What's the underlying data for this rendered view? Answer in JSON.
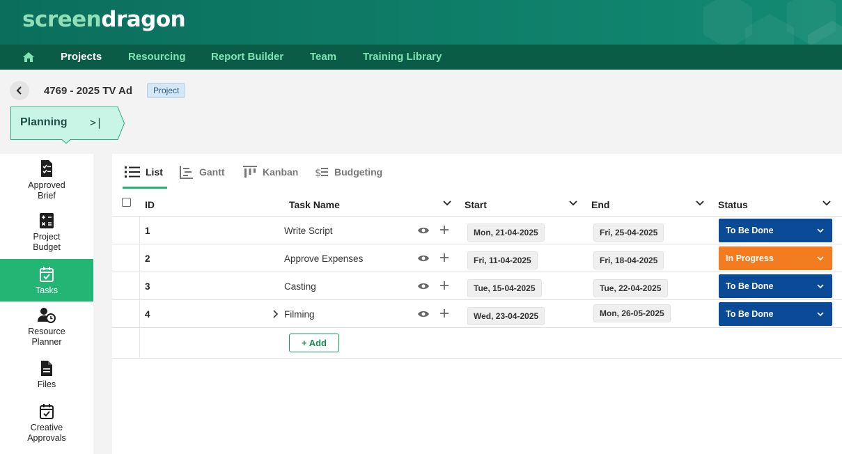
{
  "brand": {
    "part1": "screen",
    "part2": "dragon"
  },
  "nav": {
    "home_icon": "home-icon",
    "items": [
      {
        "label": "Projects",
        "active": true
      },
      {
        "label": "Resourcing"
      },
      {
        "label": "Report Builder"
      },
      {
        "label": "Team"
      },
      {
        "label": "Training Library"
      }
    ]
  },
  "project": {
    "title": "4769 - 2025 TV Ad",
    "badge": "Project"
  },
  "stage": {
    "label": "Planning",
    "collapse_glyph": ">|"
  },
  "sidebar": {
    "items": [
      {
        "label_line1": "Approved",
        "label_line2": "Brief",
        "icon": "brief-icon"
      },
      {
        "label_line1": "Project",
        "label_line2": "Budget",
        "icon": "calculator-icon"
      },
      {
        "label_line1": "Tasks",
        "icon": "calendar-check-icon",
        "active": true
      },
      {
        "label_line1": "Resource",
        "label_line2": "Planner",
        "icon": "user-clock-icon"
      },
      {
        "label_line1": "Files",
        "icon": "file-icon"
      },
      {
        "label_line1": "Creative",
        "label_line2": "Approvals",
        "icon": "calendar-check-icon"
      }
    ]
  },
  "tabs": [
    {
      "label": "List",
      "icon": "list-icon",
      "active": true
    },
    {
      "label": "Gantt",
      "icon": "gantt-icon"
    },
    {
      "label": "Kanban",
      "icon": "kanban-icon"
    },
    {
      "label": "Budgeting",
      "icon": "budget-icon"
    }
  ],
  "table": {
    "columns": {
      "id": "ID",
      "name": "Task Name",
      "start": "Start",
      "end": "End",
      "status": "Status"
    },
    "rows": [
      {
        "id": "1",
        "name": "Write Script",
        "start": "Mon, 21-04-2025",
        "end": "Fri, 25-04-2025",
        "status": "To Be Done"
      },
      {
        "id": "2",
        "name": "Approve Expenses",
        "start": "Fri, 11-04-2025",
        "end": "Fri, 18-04-2025",
        "status": "In Progress"
      },
      {
        "id": "3",
        "name": "Casting",
        "start": "Tue, 15-04-2025",
        "end": "Tue, 22-04-2025",
        "status": "To Be Done"
      },
      {
        "id": "4",
        "name": "Filming",
        "start": "Wed, 23-04-2025",
        "end": "Mon, 26-05-2025",
        "status": "To Be Done",
        "expandable": true
      }
    ],
    "add_label": "+ Add"
  },
  "colors": {
    "accent": "#22b573",
    "status_todo": "#0b4a96",
    "status_in_progress": "#f47c20",
    "nav_bg": "#0a5c46",
    "header_bg": "#0f7f6a"
  }
}
